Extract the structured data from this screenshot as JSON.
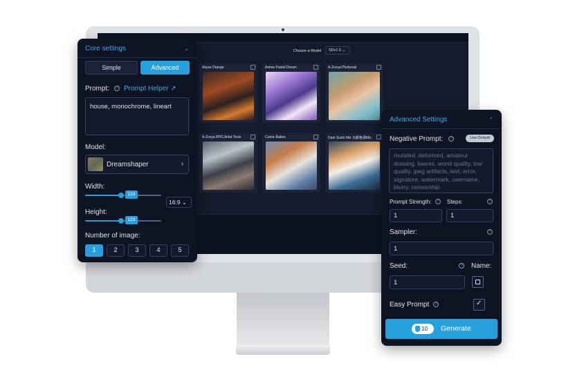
{
  "monitor": {
    "model_modal": {
      "title": "Choose a Model",
      "version": "SDv1.5 ⌄",
      "close": "×",
      "upload_icon": "⇪",
      "cards": [
        {
          "name": "Abyss Orange"
        },
        {
          "name": "Anime Pastel Dream"
        },
        {
          "name": "A-Zovya Photoreal"
        },
        {
          "name": "A-Zovya RPG Artist Tools"
        },
        {
          "name": "Comic Babes"
        },
        {
          "name": "Dark Sushi Mix 大颜色混Mix"
        }
      ]
    }
  },
  "core_settings": {
    "title": "Core settings",
    "collapse_icon": "⌄",
    "mode_simple": "Simple",
    "mode_advanced": "Advanced",
    "prompt_label": "Prompt:",
    "help": "?",
    "prompt_helper": "Prompt Helper ↗",
    "prompt_value": "house, monochrome, lineart",
    "model_label": "Model:",
    "model_value": "Dreamshaper",
    "model_arrow": "›",
    "width_label": "Width:",
    "width_value": "123",
    "height_label": "Height:",
    "height_value": "123",
    "aspect_ratio": "16:9 ⌄",
    "num_images_label": "Number of image:",
    "num_images_options": [
      "1",
      "2",
      "3",
      "4",
      "5"
    ],
    "num_images_selected": "1"
  },
  "advanced_settings": {
    "title": "Advanced Settings",
    "collapse_icon": "⌃",
    "negative_prompt_label": "Negative Prompt:",
    "use_default": "Use Default",
    "negative_prompt_placeholder": "mutated, deformed, amateur drawing, lowres, worst quality, low quality, jpeg artifacts, text, error, signature, watermark, username, blurry, censorship",
    "prompt_strength_label": "Prompt Strength:",
    "prompt_strength_value": "1",
    "steps_label": "Steps:",
    "steps_value": "1",
    "sampler_label": "Sampler:",
    "sampler_value": "1",
    "seed_label": "Seed:",
    "seed_value": "1",
    "name_label": "Name:",
    "easy_prompt_label": "Easy Prompt",
    "easy_prompt_checked": true,
    "credits": "10",
    "generate_label": "Generate"
  },
  "colors": {
    "accent": "#27a0de",
    "panel_bg": "#0f1425",
    "link": "#3fa9e3"
  }
}
